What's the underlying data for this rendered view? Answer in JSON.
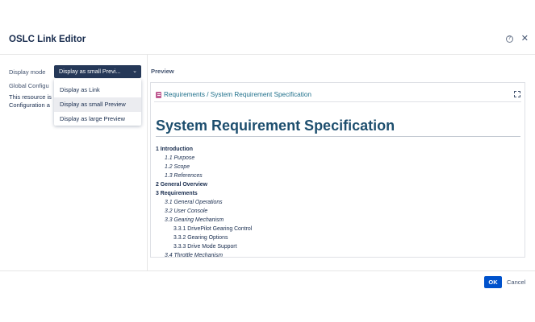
{
  "dialog": {
    "title": "OSLC Link Editor",
    "help_glyph": "?",
    "close_glyph": "✕"
  },
  "left": {
    "display_mode_label": "Display mode",
    "selected_mode": "Display as small Previ...",
    "caret": "⌄",
    "global_config_label": "Global Configu",
    "resource_text_line1": "This resource is",
    "resource_text_line2": "Configuration a"
  },
  "dropdown": {
    "options": [
      {
        "label": "Display as Link",
        "selected": false
      },
      {
        "label": "Display as small Preview",
        "selected": true
      },
      {
        "label": "Display as large Preview",
        "selected": false
      }
    ]
  },
  "preview": {
    "label": "Preview",
    "breadcrumb": "Requirements / System Requirement Specification",
    "doc_title": "System Requirement Specification",
    "toc": [
      {
        "level": 1,
        "text": "1 Introduction"
      },
      {
        "level": 2,
        "text": "1.1 Purpose"
      },
      {
        "level": 2,
        "text": "1.2 Scope"
      },
      {
        "level": 2,
        "text": "1.3 References"
      },
      {
        "level": 1,
        "text": "2 General Overview"
      },
      {
        "level": 1,
        "text": "3 Requirements"
      },
      {
        "level": 2,
        "text": "3.1 General Operations"
      },
      {
        "level": 2,
        "text": "3.2 User Console"
      },
      {
        "level": 2,
        "text": "3.3 Gearing Mechanism"
      },
      {
        "level": 3,
        "text": "3.3.1 DrivePilot Gearing Control"
      },
      {
        "level": 3,
        "text": "3.3.2 Gearing Options"
      },
      {
        "level": 3,
        "text": "3.3.3 Drive Mode Support"
      },
      {
        "level": 2,
        "text": "3.4 Throttle Mechanism"
      }
    ]
  },
  "footer": {
    "ok_label": "OK",
    "cancel_label": "Cancel"
  }
}
